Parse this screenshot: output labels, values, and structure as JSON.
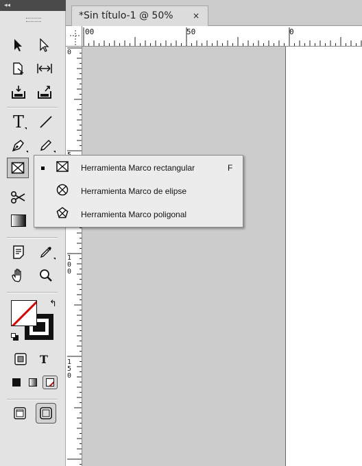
{
  "panel": {
    "collapse_label": "◂◂"
  },
  "document": {
    "tab_title": "*Sin título-1 @ 50%",
    "close_glyph": "×"
  },
  "ruler": {
    "h_labels": [
      "00",
      "50",
      "0"
    ],
    "v_labels": [
      "0",
      "5",
      "1\n0\n0",
      "1\n5\n0"
    ]
  },
  "flyout": {
    "items": [
      {
        "label": "Herramienta Marco rectangular",
        "shortcut": "F",
        "icon": "rectangle-frame-icon",
        "selected": true
      },
      {
        "label": "Herramienta Marco de elipse",
        "shortcut": "",
        "icon": "ellipse-frame-icon",
        "selected": false
      },
      {
        "label": "Herramienta Marco poligonal",
        "shortcut": "",
        "icon": "polygon-frame-icon",
        "selected": false
      }
    ]
  },
  "colors": {
    "fill_stroke_none": "#e00000",
    "panel_bg": "#e3e3e3",
    "pasteboard": "#cccccc"
  }
}
